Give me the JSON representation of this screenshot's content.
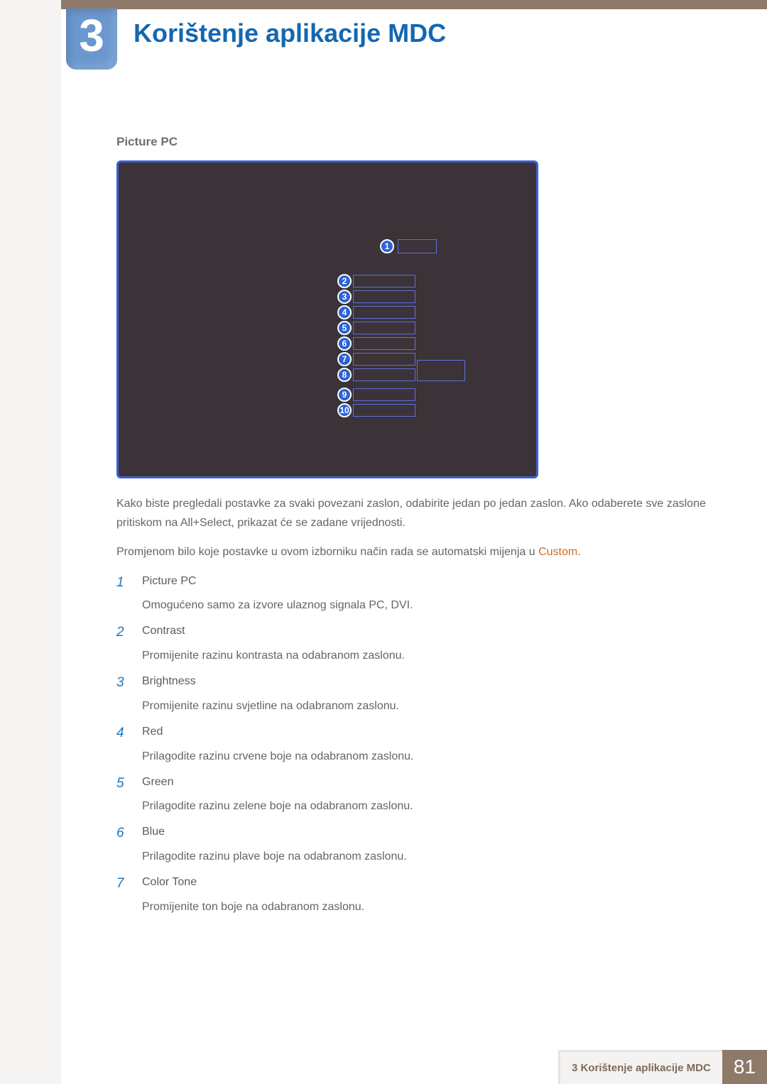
{
  "chapter": {
    "number": "3",
    "title": "Korištenje aplikacije MDC"
  },
  "section": {
    "label": "Picture PC"
  },
  "diagram": {
    "callouts": [
      "1",
      "2",
      "3",
      "4",
      "5",
      "6",
      "7",
      "8",
      "9",
      "10"
    ]
  },
  "paragraphs": {
    "p1": "Kako biste pregledali postavke za svaki povezani zaslon, odabirite jedan po jedan zaslon. Ako odaberete sve zaslone pritiskom na All+Select, prikazat će se zadane vrijednosti.",
    "p2_pre": "Promjenom bilo koje postavke u ovom izborniku način rada se automatski mijenja u ",
    "p2_custom": "Custom",
    "p2_post": "."
  },
  "items": [
    {
      "n": "1",
      "title": "Picture PC",
      "desc": "Omogućeno samo za izvore ulaznog signala PC, DVI."
    },
    {
      "n": "2",
      "title": "Contrast",
      "desc": "Promijenite razinu kontrasta na odabranom zaslonu."
    },
    {
      "n": "3",
      "title": "Brightness",
      "desc": "Promijenite razinu svjetline na odabranom zaslonu."
    },
    {
      "n": "4",
      "title": "Red",
      "desc": "Prilagodite razinu crvene boje na odabranom zaslonu."
    },
    {
      "n": "5",
      "title": "Green",
      "desc": "Prilagodite razinu zelene boje na odabranom zaslonu."
    },
    {
      "n": "6",
      "title": "Blue",
      "desc": "Prilagodite razinu plave boje na odabranom zaslonu."
    },
    {
      "n": "7",
      "title": "Color Tone",
      "desc": "Promijenite ton boje na odabranom zaslonu."
    }
  ],
  "footer": {
    "title": "3 Korištenje aplikacije MDC",
    "page": "81"
  }
}
